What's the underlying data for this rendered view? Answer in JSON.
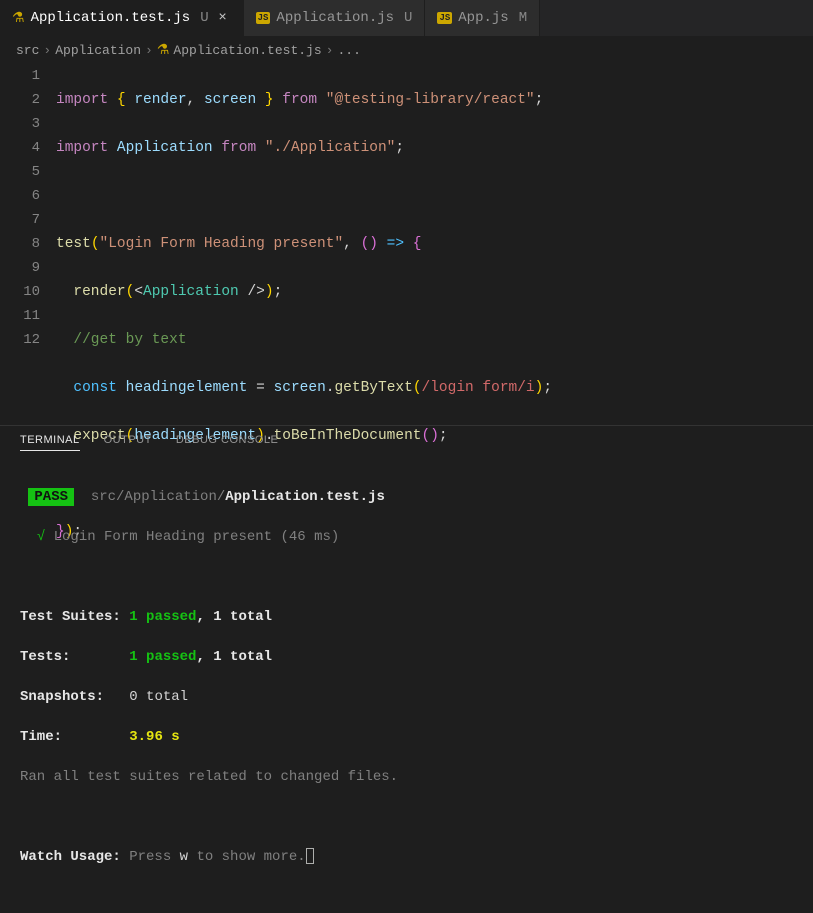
{
  "tabs": [
    {
      "name": "Application.test.js",
      "status": "U",
      "active": true,
      "icon": "flask"
    },
    {
      "name": "Application.js",
      "status": "U",
      "active": false,
      "icon": "js"
    },
    {
      "name": "App.js",
      "status": "M",
      "active": false,
      "icon": "js"
    }
  ],
  "breadcrumbs": {
    "parts": [
      "src",
      "Application",
      "Application.test.js",
      "..."
    ],
    "sep": "›"
  },
  "code": {
    "lines": [
      "1",
      "2",
      "3",
      "4",
      "5",
      "6",
      "7",
      "8",
      "9",
      "10",
      "11",
      "12"
    ],
    "l1": {
      "import": "import",
      "lb": "{",
      "render": "render",
      "comma": ",",
      "screen": "screen",
      "rb": "}",
      "from": "from",
      "str": "\"@testing-library/react\""
    },
    "l2": {
      "import": "import",
      "app": "Application",
      "from": "from",
      "str": "\"./Application\""
    },
    "l4": {
      "fn": "test",
      "lp": "(",
      "str": "\"Login Form Heading present\"",
      "comma": ",",
      "arrow": "() =>",
      "lb": "{"
    },
    "l5": {
      "fn": "render",
      "lp": "(",
      "la": "<",
      "tag": "Application",
      "ra": "/>",
      "rp": ")"
    },
    "l6": {
      "comment": "//get by text"
    },
    "l7": {
      "const": "const",
      "var": "headingelement",
      "eq": "=",
      "obj": "screen",
      "dot": ".",
      "fn": "getByText",
      "lp": "(",
      "regex": "/login form/i",
      "rp": ")"
    },
    "l8": {
      "fn": "expect",
      "lp": "(",
      "var": "headingelement",
      "rp": ")",
      "dot": ".",
      "fn2": "toBeInTheDocument",
      "lp2": "(",
      "rp2": ")"
    },
    "l10": {
      "rb": "}",
      "rp": ")"
    }
  },
  "panel": {
    "tabs": [
      "TERMINAL",
      "OUTPUT",
      "DEBUG CONSOLE"
    ]
  },
  "terminal": {
    "pass": "PASS",
    "path_dim": "src/Application/",
    "path_bold": "Application.test.js",
    "check": "√",
    "test_name": "Login Form Heading present (46 ms)",
    "suites_label": "Test Suites:",
    "suites_pass": "1 passed",
    "suites_total": ", 1 total",
    "tests_label": "Tests:",
    "tests_pass": "1 passed",
    "tests_total": ", 1 total",
    "snap_label": "Snapshots:",
    "snap_val": "0 total",
    "time_label": "Time:",
    "time_val": "3.96 s",
    "ran": "Ran all test suites related to changed files.",
    "watch_label": "Watch Usage:",
    "watch_press": " Press ",
    "watch_key": "w",
    "watch_rest": " to show more."
  }
}
